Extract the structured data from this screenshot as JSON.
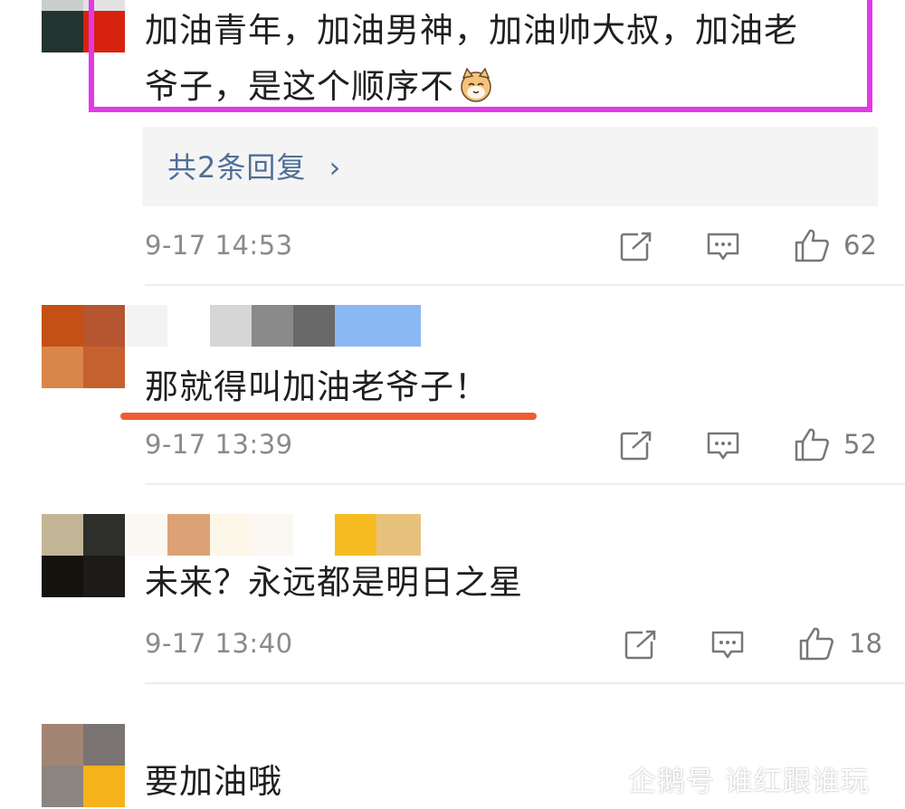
{
  "comments": [
    {
      "text_line1": "加油青年，加油男神，加油帅大叔，加油老",
      "text_line2": "爷子，是这个顺序不",
      "emoji": "cat-emoji",
      "replies_link": "共2条回复",
      "replies_chevron": "›",
      "time": "9-17 14:53",
      "likes": "62"
    },
    {
      "text": "那就得叫加油老爷子！",
      "time": "9-17 13:39",
      "likes": "52"
    },
    {
      "text": "未来？永远都是明日之星",
      "time": "9-17 13:40",
      "likes": "18"
    },
    {
      "text": "要加油哦"
    }
  ],
  "icons": {
    "share": "share-icon",
    "comment": "comment-icon",
    "like": "thumbs-up-icon"
  },
  "colors": {
    "highlight_border": "#e239e6",
    "underline": "#ee5d33",
    "link": "#4f6f98",
    "meta": "#8a8a8a"
  },
  "watermark": {
    "text": "企鹅号 谁红跟谁玩"
  }
}
